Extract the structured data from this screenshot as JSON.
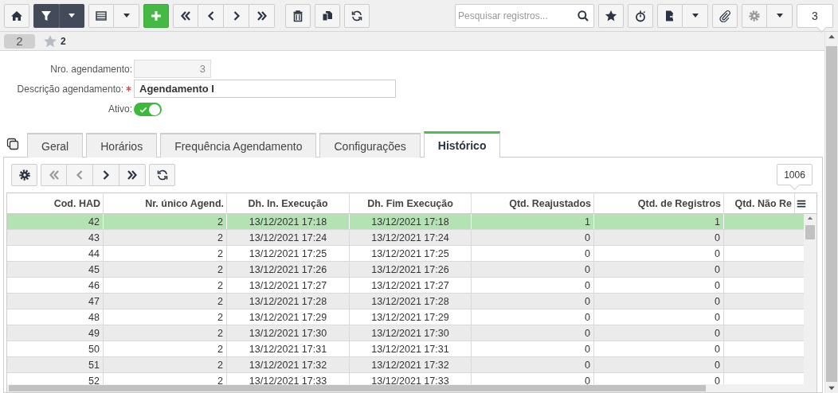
{
  "toolbar": {
    "search": {
      "placeholder": "Pesquisar registros..."
    },
    "record_count": "3"
  },
  "record_bar": {
    "badge": "2",
    "favorites": "2"
  },
  "form": {
    "fields": [
      {
        "kind": "number_input",
        "label": "Nro. agendamento:",
        "value": "3",
        "required": false,
        "disabled": true
      },
      {
        "kind": "text_input",
        "label": "Descrição agendamento:",
        "value": "Agendamento I",
        "required": true,
        "disabled": false
      },
      {
        "kind": "switch",
        "label": "Ativo:",
        "on": true
      }
    ]
  },
  "tabs": [
    {
      "label": "Geral",
      "selected": false
    },
    {
      "label": "Horários",
      "selected": false
    },
    {
      "label": "Frequência Agendamento",
      "selected": false
    },
    {
      "label": "Configurações",
      "selected": false
    },
    {
      "label": "Histórico",
      "selected": true
    }
  ],
  "grid": {
    "record_count": "1006",
    "columns": [
      {
        "label": "Cod. HAD",
        "kind": "number"
      },
      {
        "label": "Nr. único Agend.",
        "kind": "number"
      },
      {
        "label": "Dh. In. Execução",
        "kind": "datetime"
      },
      {
        "label": "Dh. Fim Execução",
        "kind": "datetime"
      },
      {
        "label": "Qtd. Reajustados",
        "kind": "number"
      },
      {
        "label": "Qtd. de Registros",
        "kind": "number"
      },
      {
        "label": "Qtd. Não Re",
        "kind": "number"
      }
    ],
    "rows": [
      {
        "cells": [
          "42",
          "2",
          "13/12/2021 17:18",
          "13/12/2021 17:18",
          "1",
          "1"
        ],
        "selected": true
      },
      {
        "cells": [
          "43",
          "2",
          "13/12/2021 17:24",
          "13/12/2021 17:24",
          "0",
          "0"
        ],
        "selected": false
      },
      {
        "cells": [
          "44",
          "2",
          "13/12/2021 17:25",
          "13/12/2021 17:25",
          "0",
          "0"
        ],
        "selected": false
      },
      {
        "cells": [
          "45",
          "2",
          "13/12/2021 17:26",
          "13/12/2021 17:26",
          "0",
          "0"
        ],
        "selected": false
      },
      {
        "cells": [
          "46",
          "2",
          "13/12/2021 17:27",
          "13/12/2021 17:27",
          "0",
          "0"
        ],
        "selected": false
      },
      {
        "cells": [
          "47",
          "2",
          "13/12/2021 17:28",
          "13/12/2021 17:28",
          "0",
          "0"
        ],
        "selected": false
      },
      {
        "cells": [
          "48",
          "2",
          "13/12/2021 17:29",
          "13/12/2021 17:29",
          "0",
          "0"
        ],
        "selected": false
      },
      {
        "cells": [
          "49",
          "2",
          "13/12/2021 17:30",
          "13/12/2021 17:30",
          "0",
          "0"
        ],
        "selected": false
      },
      {
        "cells": [
          "50",
          "2",
          "13/12/2021 17:31",
          "13/12/2021 17:31",
          "0",
          "0"
        ],
        "selected": false
      },
      {
        "cells": [
          "51",
          "2",
          "13/12/2021 17:32",
          "13/12/2021 17:32",
          "0",
          "0"
        ],
        "selected": false
      },
      {
        "cells": [
          "52",
          "2",
          "13/12/2021 17:33",
          "13/12/2021 17:33",
          "0",
          "0"
        ],
        "selected": false
      }
    ]
  }
}
